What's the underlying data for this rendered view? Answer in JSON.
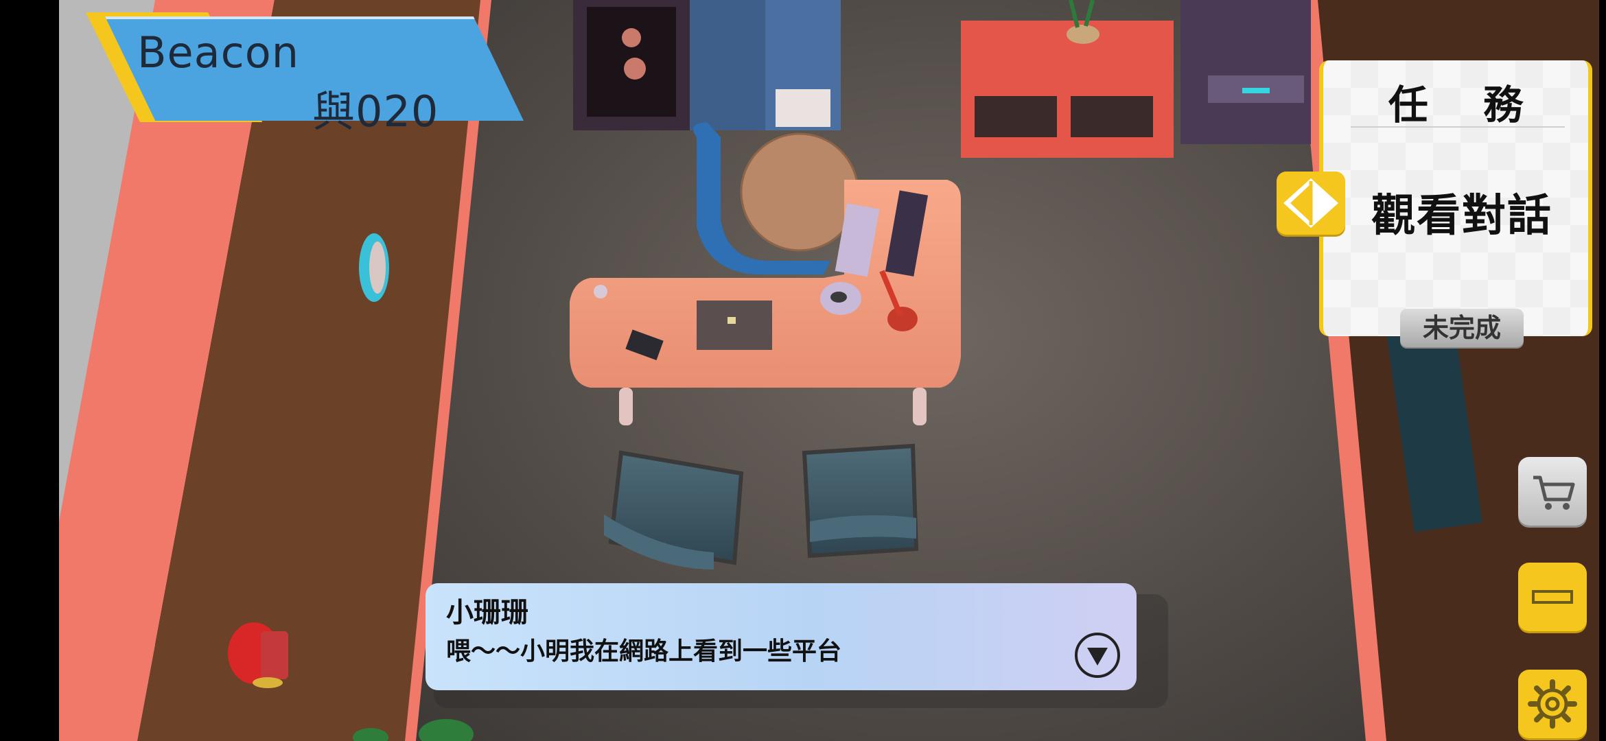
{
  "hud": {
    "beacon_title": "Beacon",
    "beacon_subtitle": "與020"
  },
  "mission": {
    "heading": "任 務",
    "task": "觀看對話",
    "status": "未完成"
  },
  "buttons": {
    "cart_icon": "cart-icon",
    "minus_icon": "minus-icon",
    "settings_icon": "gear-icon"
  },
  "dialogue": {
    "speaker": "小珊珊",
    "text": "喂～～小明我在網路上看到一些平台"
  },
  "colors": {
    "accent_yellow": "#f5c61e",
    "banner_blue": "#4ba3e0",
    "floor": "#5a5450"
  }
}
